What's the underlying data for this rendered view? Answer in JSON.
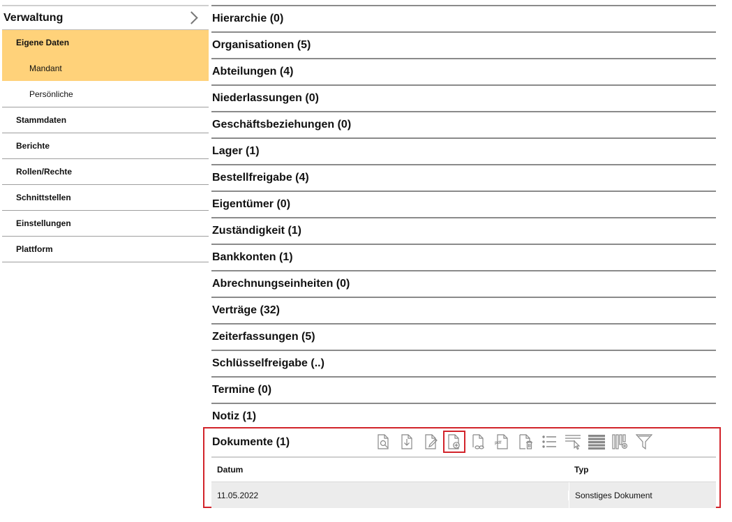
{
  "sidebar": {
    "title": "Verwaltung",
    "items": [
      {
        "label": "Eigene Daten",
        "state": "active"
      },
      {
        "label": "Mandant",
        "state": "active-sub"
      },
      {
        "label": "Persönliche",
        "state": "sub"
      },
      {
        "label": "Stammdaten"
      },
      {
        "label": "Berichte"
      },
      {
        "label": "Rollen/Rechte"
      },
      {
        "label": "Schnittstellen"
      },
      {
        "label": "Einstellungen"
      },
      {
        "label": "Plattform"
      }
    ]
  },
  "sections": [
    "Hierarchie (0)",
    "Organisationen (5)",
    "Abteilungen (4)",
    "Niederlassungen (0)",
    "Geschäftsbeziehungen (0)",
    "Lager (1)",
    "Bestellfreigabe (4)",
    "Eigentümer (0)",
    "Zuständigkeit (1)",
    "Bankkonten (1)",
    "Abrechnungseinheiten (0)",
    "Verträge (32)",
    "Zeiterfassungen (5)",
    "Schlüsselfreigabe (..)",
    "Termine (0)",
    "Notiz (1)"
  ],
  "documents": {
    "title": "Dokumente (1)",
    "toolbar_icons": [
      "view-document-icon",
      "download-document-icon",
      "edit-document-icon",
      "add-document-icon",
      "link-document-icon",
      "pdf-document-icon",
      "delete-document-icon",
      "list-icon",
      "select-columns-icon",
      "rows-icon",
      "column-settings-icon",
      "filter-icon"
    ],
    "columns": {
      "date": "Datum",
      "type": "Typ"
    },
    "rows": [
      {
        "date": "11.05.2022",
        "type": "Sonstiges Dokument"
      }
    ]
  },
  "colors": {
    "accent": "#ffd27a",
    "highlight": "#d2232a"
  }
}
